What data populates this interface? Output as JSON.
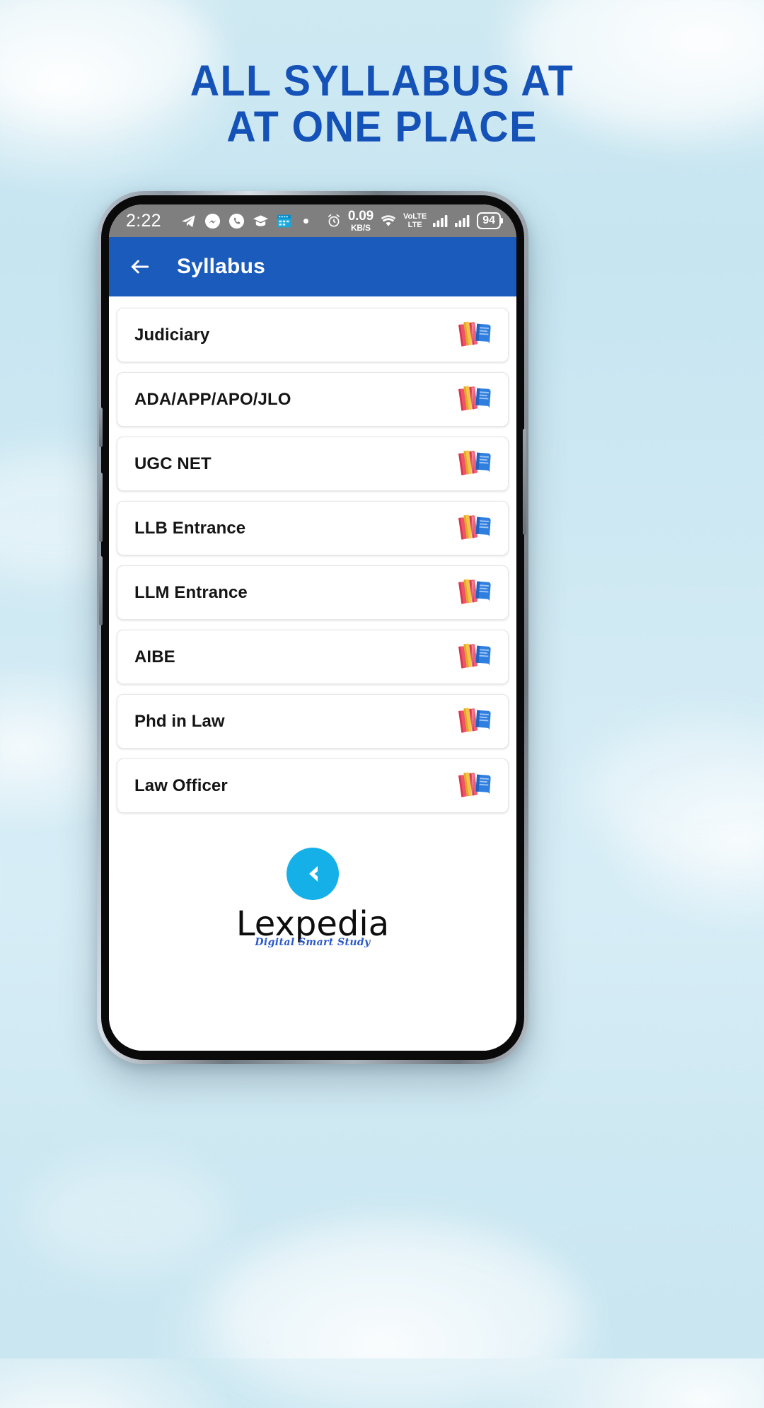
{
  "headline": {
    "line1": "ALL SYLLABUS AT",
    "line2": "AT ONE PLACE",
    "color": "#1552b8"
  },
  "statusbar": {
    "time": "2:22",
    "left_icons": [
      "telegram-icon",
      "messenger-icon",
      "whatsapp-icon",
      "graduation-cap-icon",
      "calendar-icon",
      "dot-indicator"
    ],
    "alarm_icon": "alarm-clock-icon",
    "network_speed_value": "0.09",
    "network_speed_unit": "KB/S",
    "wifi_icon": "wifi-icon",
    "volte_line1": "VoLTE",
    "volte_line2": "LTE",
    "signal_icon_1": "signal-bars-icon",
    "signal_icon_2": "signal-bars-icon",
    "battery_level": "94"
  },
  "appbar": {
    "back_icon": "back-arrow-icon",
    "title": "Syllabus",
    "background": "#1b5bbc"
  },
  "list": {
    "items": [
      {
        "label": "Judiciary",
        "icon": "books-icon"
      },
      {
        "label": "ADA/APP/APO/JLO",
        "icon": "books-icon"
      },
      {
        "label": "UGC NET",
        "icon": "books-icon"
      },
      {
        "label": "LLB Entrance",
        "icon": "books-icon"
      },
      {
        "label": "LLM Entrance",
        "icon": "books-icon"
      },
      {
        "label": "AIBE",
        "icon": "books-icon"
      },
      {
        "label": "Phd in Law",
        "icon": "books-icon"
      },
      {
        "label": "Law Officer",
        "icon": "books-icon"
      }
    ]
  },
  "footer": {
    "logo_icon": "lexpedia-chevron-logo",
    "brand": "Lexpedia",
    "tagline": "Digital Smart Study",
    "logo_color": "#15b0e8"
  }
}
